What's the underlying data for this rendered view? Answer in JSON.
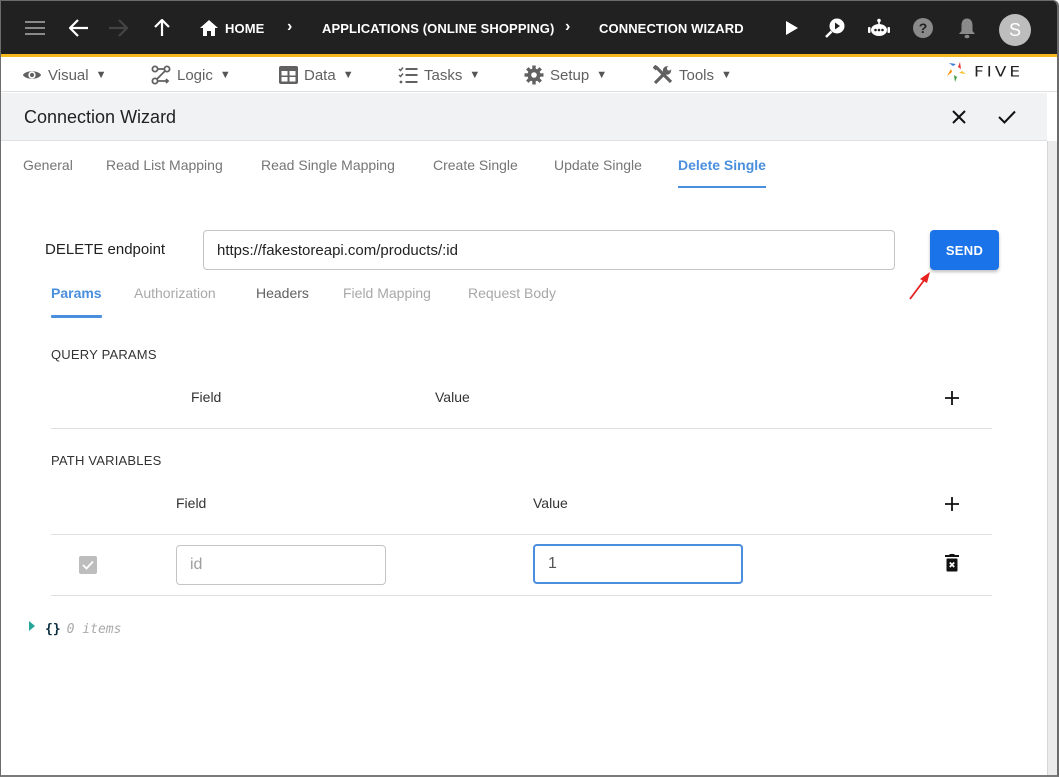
{
  "topbar": {
    "icons": [
      "menu-icon",
      "back-arrow-icon",
      "forward-arrow-icon",
      "up-arrow-icon",
      "home-icon"
    ],
    "breadcrumbs": [
      "HOME",
      "APPLICATIONS (ONLINE SHOPPING)",
      "CONNECTION WIZARD"
    ],
    "right_icons": [
      "play-icon",
      "search-play-icon",
      "chatbot-icon",
      "help-icon",
      "bell-icon"
    ],
    "avatar_letter": "S",
    "accent_color": "#f5b91e"
  },
  "menubar": {
    "items": [
      {
        "label": "Visual",
        "icon": "eye-icon"
      },
      {
        "label": "Logic",
        "icon": "logic-flow-icon"
      },
      {
        "label": "Data",
        "icon": "table-grid-icon"
      },
      {
        "label": "Tasks",
        "icon": "checklist-icon"
      },
      {
        "label": "Setup",
        "icon": "gear-icon"
      },
      {
        "label": "Tools",
        "icon": "wrench-screwdriver-icon"
      }
    ],
    "caret": "▼",
    "logo_text": "FIVE"
  },
  "header": {
    "title": "Connection Wizard",
    "close_icon": "close-icon",
    "confirm_icon": "check-icon"
  },
  "tabs": {
    "items": [
      "General",
      "Read List Mapping",
      "Read Single Mapping",
      "Create Single",
      "Update Single",
      "Delete Single"
    ],
    "active": "Delete Single",
    "active_color": "#4a8fdd"
  },
  "endpoint": {
    "label": "DELETE endpoint",
    "value": "https://fakestoreapi.com/products/:id",
    "send_label": "SEND",
    "send_color": "#1a73e8"
  },
  "subtabs": {
    "items": [
      "Params",
      "Authorization",
      "Headers",
      "Field Mapping",
      "Request Body"
    ],
    "active": "Params"
  },
  "query_params": {
    "title": "QUERY PARAMS",
    "columns": [
      "Field",
      "Value"
    ],
    "rows": []
  },
  "path_variables": {
    "title": "PATH VARIABLES",
    "columns": [
      "Field",
      "Value"
    ],
    "rows": [
      {
        "checked": true,
        "field": "id",
        "value": "1"
      }
    ]
  },
  "json_viewer": {
    "braces": "{}",
    "count_text": "0 items"
  }
}
